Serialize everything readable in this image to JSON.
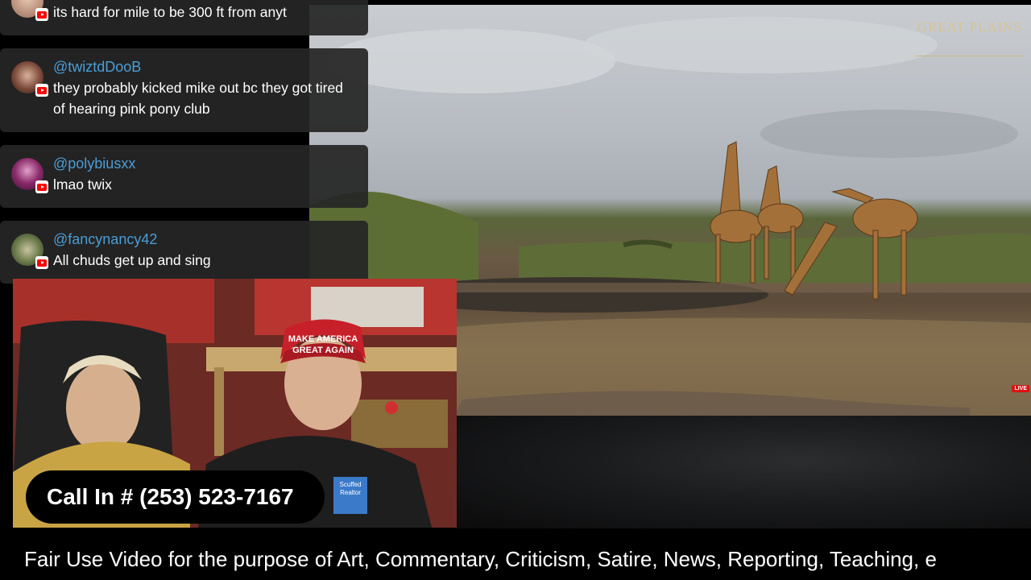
{
  "stream": {
    "watermark": "GREAT PLAINS",
    "live_badge": "LIVE"
  },
  "chat": {
    "messages": [
      {
        "user": "",
        "text": "its hard for mile to be 300 ft from anyt"
      },
      {
        "user": "@twiztdDooB",
        "text": "they probably kicked mike out bc they got tired of hearing pink pony club"
      },
      {
        "user": "@polybiusxx",
        "text": "lmao twix"
      },
      {
        "user": "@fancynancy42",
        "text": "All chuds get up and sing"
      }
    ]
  },
  "webcam": {
    "hat_text": "MAKE AMERICA GREAT AGAIN",
    "shirt_badge": "Scuffed Realtor"
  },
  "callin": {
    "label": "Call In # (253) 523-7167"
  },
  "footer": {
    "disclaimer": "Fair Use Video for the purpose of Art, Commentary, Criticism, Satire, News, Reporting, Teaching, e"
  },
  "colors": {
    "username": "#4a9ed6",
    "chat_bg": "#262626",
    "hat_red": "#c8202a",
    "youtube_red": "#ff0000"
  }
}
